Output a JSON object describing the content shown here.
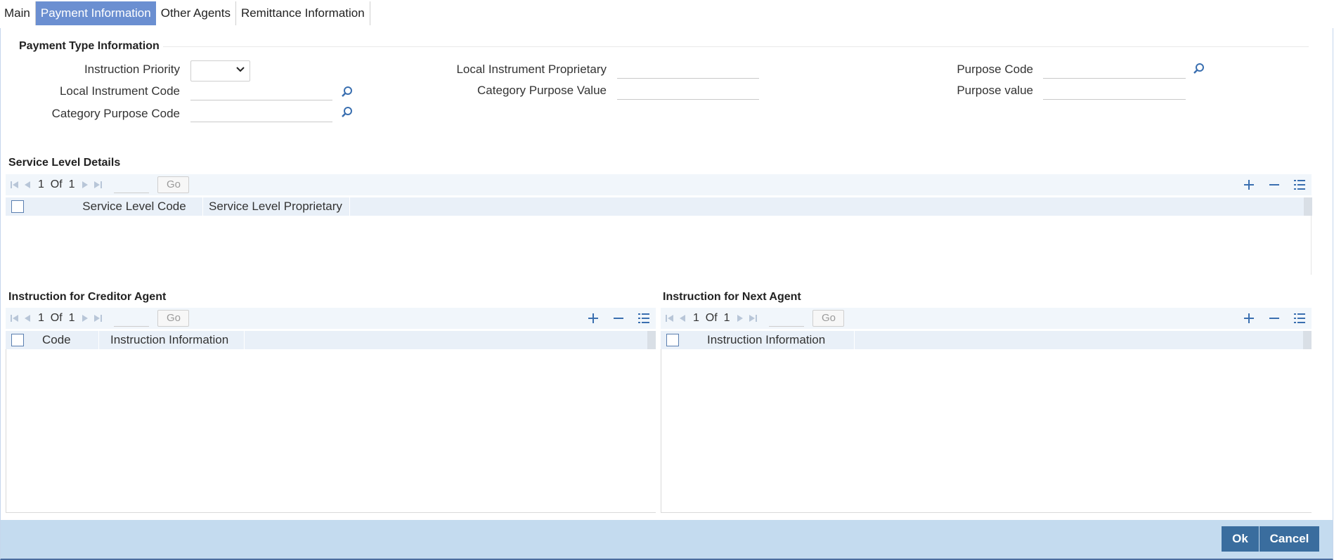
{
  "tabs": [
    {
      "label": "Main"
    },
    {
      "label": "Payment Information"
    },
    {
      "label": "Other Agents"
    },
    {
      "label": "Remittance Information"
    }
  ],
  "payment_type": {
    "title": "Payment Type Information",
    "instruction_priority": {
      "label": "Instruction Priority",
      "value": ""
    },
    "local_instrument_code": {
      "label": "Local Instrument Code",
      "value": ""
    },
    "category_purpose_code": {
      "label": "Category Purpose Code",
      "value": ""
    },
    "local_instrument_proprietary": {
      "label": "Local Instrument Proprietary",
      "value": ""
    },
    "category_purpose_value": {
      "label": "Category Purpose Value",
      "value": ""
    },
    "purpose_code": {
      "label": "Purpose Code",
      "value": ""
    },
    "purpose_value": {
      "label": "Purpose value",
      "value": ""
    }
  },
  "service_level": {
    "title": "Service Level Details",
    "page": "1",
    "of_label": "Of",
    "total": "1",
    "go_label": "Go",
    "columns": [
      "Service Level Code",
      "Service Level Proprietary"
    ]
  },
  "creditor_agent": {
    "title": "Instruction for Creditor Agent",
    "page": "1",
    "of_label": "Of",
    "total": "1",
    "go_label": "Go",
    "columns": [
      "Code",
      "Instruction Information"
    ]
  },
  "next_agent": {
    "title": "Instruction for Next Agent",
    "page": "1",
    "of_label": "Of",
    "total": "1",
    "go_label": "Go",
    "columns": [
      "Instruction Information"
    ]
  },
  "footer": {
    "ok_label": "Ok",
    "cancel_label": "Cancel"
  },
  "colors": {
    "active_tab": "#6b8fd1",
    "footer_bg": "#c4dbef",
    "button_bg": "#3a6d9e",
    "grid_header": "#e9f0f8"
  }
}
